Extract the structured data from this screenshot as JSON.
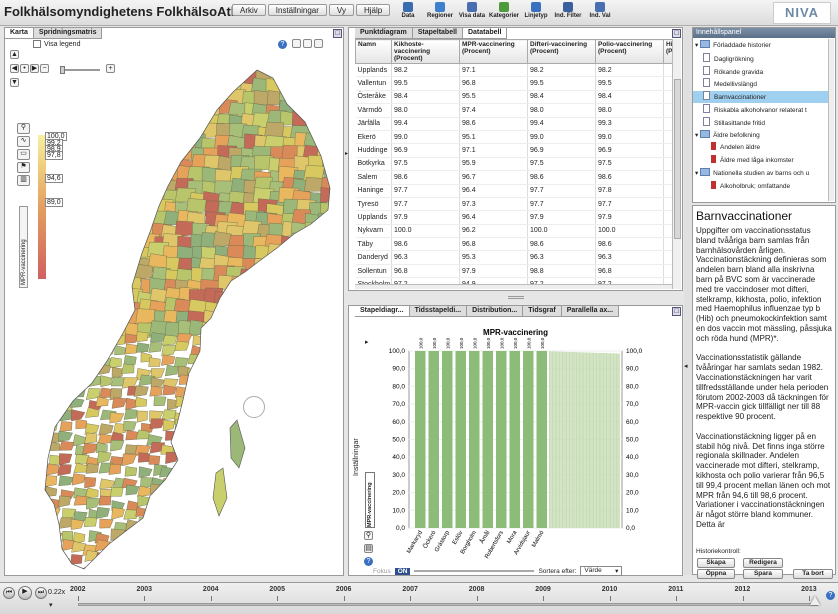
{
  "app": {
    "title": "Folkhälsomyndighetens FolkhälsoAtlas"
  },
  "menu": [
    "Arkiv",
    "Inställningar",
    "Vy",
    "Hjälp"
  ],
  "toolbar": [
    {
      "label": "Data",
      "color": "#3a6db0"
    },
    {
      "label": "Regioner",
      "color": "#3f7fd0"
    },
    {
      "label": "Visa data",
      "color": "#4a6fb0"
    },
    {
      "label": "Kategorier",
      "color": "#4c9a3c"
    },
    {
      "label": "Linjetyp",
      "color": "#3a70c0"
    },
    {
      "label": "Ind. Filter",
      "color": "#3a60a0"
    },
    {
      "label": "Ind. Val",
      "color": "#4870b0"
    }
  ],
  "logo": "NIVA",
  "map": {
    "tabs": [
      "Karta",
      "Spridningsmatris"
    ],
    "legend_label": "Visa legend",
    "side_label": "MPR-vaccinering",
    "legend_values": [
      "100,0",
      "99,2",
      "98,9",
      "97,8",
      "94,6",
      "89,0"
    ]
  },
  "table": {
    "tabs": [
      "Punktdiagram",
      "Stapeltabell",
      "Datatabell"
    ],
    "active_tab": 2,
    "headers": [
      "Namn",
      "Kikhoste-vaccinering (Procent)",
      "MPR-vaccinering (Procent)",
      "Difteri-vaccinering (Procent)",
      "Polio-vaccinering (Procent)",
      "Hib (Pro"
    ],
    "rows": [
      [
        "Upplands",
        98.2,
        97.1,
        98.2,
        98.2,
        ""
      ],
      [
        "Vallentun",
        99.5,
        96.8,
        99.5,
        99.5,
        ""
      ],
      [
        "Österåke",
        98.4,
        95.5,
        98.4,
        98.4,
        ""
      ],
      [
        "Värmdö",
        98.0,
        97.4,
        98.0,
        98.0,
        ""
      ],
      [
        "Järfälla",
        99.4,
        98.6,
        99.4,
        99.3,
        ""
      ],
      [
        "Ekerö",
        99.0,
        95.1,
        99.0,
        99.0,
        ""
      ],
      [
        "Huddinge",
        96.9,
        97.1,
        96.9,
        96.9,
        ""
      ],
      [
        "Botkyrka",
        97.5,
        95.9,
        97.5,
        97.5,
        ""
      ],
      [
        "Salem",
        98.6,
        96.7,
        98.6,
        98.6,
        ""
      ],
      [
        "Haninge",
        97.7,
        96.4,
        97.7,
        97.8,
        ""
      ],
      [
        "Tyresö",
        97.7,
        97.3,
        97.7,
        97.7,
        ""
      ],
      [
        "Upplands",
        97.9,
        96.4,
        97.9,
        97.9,
        ""
      ],
      [
        "Nykvarn",
        100.0,
        96.2,
        100.0,
        100.0,
        ""
      ],
      [
        "Täby",
        98.6,
        96.8,
        98.6,
        98.6,
        ""
      ],
      [
        "Danderyd",
        96.3,
        95.3,
        96.3,
        96.3,
        ""
      ],
      [
        "Sollentun",
        96.8,
        97.9,
        98.8,
        96.8,
        ""
      ],
      [
        "Stockholm",
        97.2,
        94.9,
        97.2,
        97.2,
        ""
      ],
      [
        "Södertälje",
        97.1,
        95.5,
        97.1,
        97.1,
        ""
      ]
    ]
  },
  "chart": {
    "tabs": [
      "Stapeldiagr...",
      "Tidsstapeldi...",
      "Distribution...",
      "Tidsgraf",
      "Parallella ax..."
    ],
    "side_label": "Inställningar",
    "dropdown_label": "MPR-vaccinering",
    "fokus_label": "Fokus",
    "toggle": "ON",
    "sort_label": "Sortera efter:",
    "sort_value": "Värde"
  },
  "chart_data": {
    "type": "bar",
    "title": "MPR-vaccinering",
    "ylim": [
      0,
      100
    ],
    "yticks": [
      "100,0",
      "90,0",
      "80,0",
      "70,0",
      "60,0",
      "50,0",
      "40,0",
      "30,0",
      "20,0",
      "10,0",
      "0,0"
    ],
    "categories": [
      "Markaryd",
      "Öckerö",
      "Grästorp",
      "Eslöv",
      "Borgholm",
      "Åmål",
      "Robertsfors",
      "Mora",
      "Arvidsjaur",
      "Malmö"
    ],
    "values": [
      100.0,
      100.0,
      100.0,
      100.0,
      100.0,
      100.0,
      100.0,
      100.0,
      100.0,
      100.0
    ],
    "rest_count": 50,
    "rest_values_start": 99.8,
    "rest_values_end": 98.6,
    "bar_color": "#8dbb78",
    "rest_color": "#c6dcb4"
  },
  "info": {
    "header": "Innehållspanel",
    "tree": [
      {
        "label": "Förladdade historier",
        "level": 0,
        "type": "folder"
      },
      {
        "label": "Dagligrökning",
        "level": 1,
        "type": "doc"
      },
      {
        "label": "Rökande gravida",
        "level": 1,
        "type": "doc"
      },
      {
        "label": "Medellivslängd",
        "level": 1,
        "type": "doc"
      },
      {
        "label": "Barnvaccinationer",
        "level": 1,
        "type": "doc",
        "selected": true
      },
      {
        "label": "Riskabla alkoholvanor relaterat t",
        "level": 1,
        "type": "doc"
      },
      {
        "label": "Stillasittande fritid",
        "level": 1,
        "type": "doc"
      },
      {
        "label": "Äldre befolkning",
        "level": 0,
        "type": "folder"
      },
      {
        "label": "Andelen äldre",
        "level": 2,
        "type": "red"
      },
      {
        "label": "Äldre med låga inkomster",
        "level": 2,
        "type": "red"
      },
      {
        "label": "Nationella studien av barns och u",
        "level": 0,
        "type": "folder"
      },
      {
        "label": "Alkoholbruk; omfattande",
        "level": 2,
        "type": "red"
      }
    ]
  },
  "description": {
    "title": "Barnvaccinationer",
    "text": "Uppgifter om vaccinationsstatus bland tvååriga barn samlas från barnhälsovården årligen. Vaccinationstäckning definieras som andelen barn bland alla inskrivna barn på BVC som är vaccinerade med tre vaccindoser mot difteri, stelkramp, kikhosta, polio, infektion med Haemophilus influenzae typ b (Hib) och pneumokockinfektion samt en dos vaccin mot mässling, påssjuka och röda hund (MPR)*.\n\nVaccinationsstatistik gällande tvååringar har samlats sedan 1982. Vaccinationstäckningen har varit tillfredsställande under hela perioden förutom 2002-2003 då täckningen för MPR-vaccin gick tillfälligt ner till 88 respektive 90 procent.\n\nVaccinationstäckning ligger på en stabil hög nivå. Det finns inga större regionala skillnader. Andelen vaccinerade mot difteri, stelkramp, kikhosta och polio varierar från 96,5 till 99,4 procent mellan länen och mot MPR från 94,6 till 98,6 procent. Variationer i vaccinationstäckningen är något större bland kommuner. Detta är",
    "history_label": "Historiekontroll:",
    "buttons": [
      "Skapa",
      "Redigera",
      "Öppna",
      "Spara",
      "Ta bort"
    ]
  },
  "timeline": {
    "speed": "0.22x",
    "years": [
      "2002",
      "2003",
      "2004",
      "2005",
      "2006",
      "2007",
      "2008",
      "2009",
      "2010",
      "2011",
      "2012",
      "2013"
    ]
  }
}
